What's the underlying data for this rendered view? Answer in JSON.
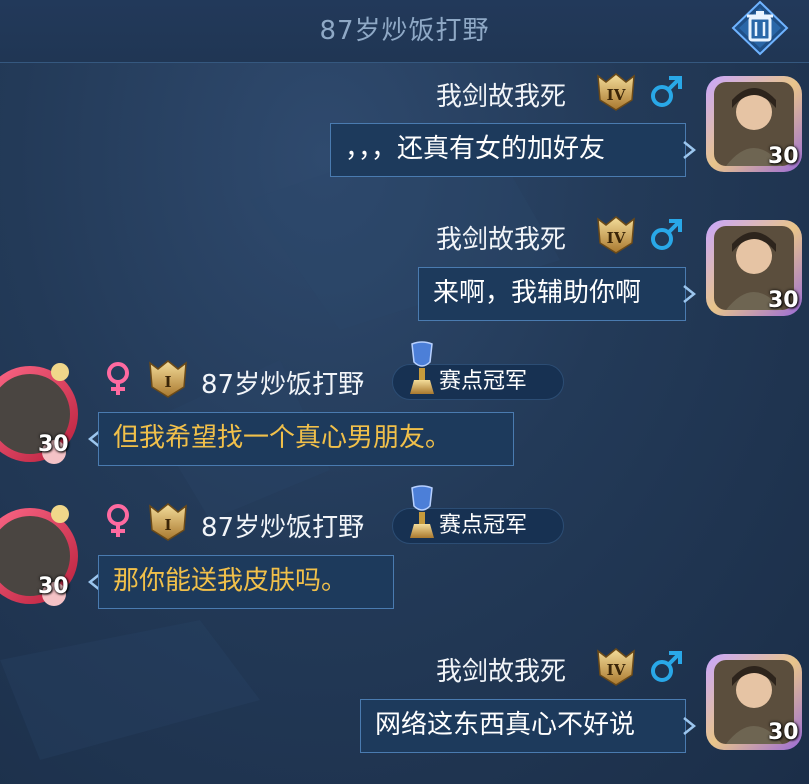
{
  "header": {
    "title": "87岁炒饭打野",
    "trash_icon": "trash-icon"
  },
  "colors": {
    "self_text": "#ffffff",
    "other_text": "#f1c04a",
    "bubble_border": "#4a7bb0",
    "female": "#ff6aa0",
    "male": "#29a8e8",
    "rank_gold": "#d8b461"
  },
  "messages": [
    {
      "sender": "我剑故我死",
      "side": "right",
      "rank": "IV",
      "gender": "male",
      "text": "，，，还真有女的加好友",
      "level": "30"
    },
    {
      "sender": "我剑故我死",
      "side": "right",
      "rank": "IV",
      "gender": "male",
      "text": "来啊，我辅助你啊",
      "level": "30"
    },
    {
      "sender": "87岁炒饭打野",
      "side": "left",
      "rank": "I",
      "gender": "female",
      "badge": "赛点冠军",
      "text": "但我希望找一个真心男朋友。",
      "level": "30"
    },
    {
      "sender": "87岁炒饭打野",
      "side": "left",
      "rank": "I",
      "gender": "female",
      "badge": "赛点冠军",
      "text": "那你能送我皮肤吗。",
      "level": "30"
    },
    {
      "sender": "我剑故我死",
      "side": "right",
      "rank": "IV",
      "gender": "male",
      "text": "网络这东西真心不好说",
      "level": "30"
    }
  ]
}
